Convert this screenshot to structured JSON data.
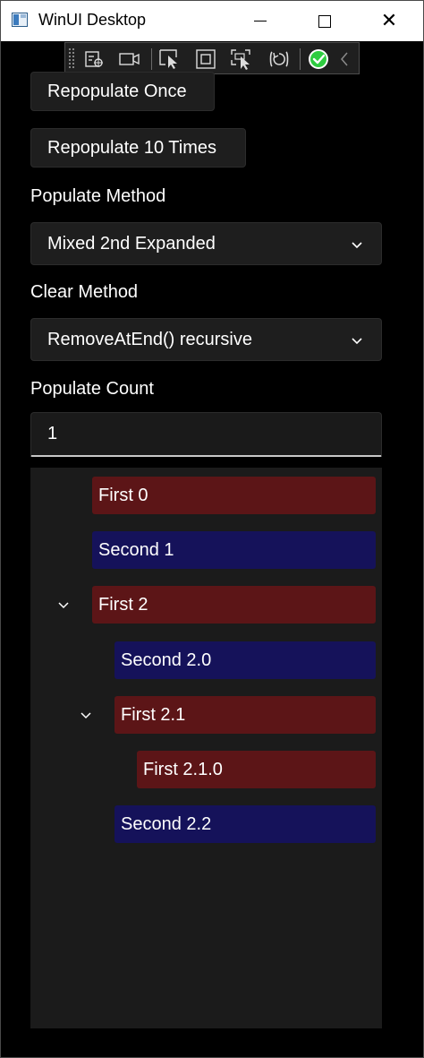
{
  "window": {
    "title": "WinUI Desktop"
  },
  "titlebar_buttons": {
    "minimize_icon": "minimize-icon",
    "maximize_icon": "maximize-icon",
    "close_icon": "close-icon",
    "close_glyph": "✕"
  },
  "devtools": {
    "icons": [
      "live-visual-tree-icon",
      "record-icon",
      "select-element-icon",
      "display-layout-adorners-icon",
      "track-focus-icon",
      "hot-reload-icon",
      "binding-check-icon",
      "collapse-toolbar-icon"
    ],
    "status_color": "#2ecc40"
  },
  "buttons": {
    "repopulate_once": "Repopulate Once",
    "repopulate_10": "Repopulate 10 Times"
  },
  "populate_method": {
    "label": "Populate Method",
    "selected": "Mixed 2nd Expanded"
  },
  "clear_method": {
    "label": "Clear Method",
    "selected": "RemoveAtEnd() recursive"
  },
  "populate_count": {
    "label": "Populate Count",
    "value": "1"
  },
  "tree": {
    "colors": {
      "first": "#5c1517",
      "second": "#15125a"
    },
    "items": [
      {
        "text": "First 0",
        "kind": "first",
        "level": 0,
        "expanded": false,
        "has_children": false
      },
      {
        "text": "Second 1",
        "kind": "second",
        "level": 0,
        "expanded": false,
        "has_children": false
      },
      {
        "text": "First 2",
        "kind": "first",
        "level": 0,
        "expanded": true,
        "has_children": true
      },
      {
        "text": "Second 2.0",
        "kind": "second",
        "level": 1,
        "expanded": false,
        "has_children": false
      },
      {
        "text": "First 2.1",
        "kind": "first",
        "level": 1,
        "expanded": true,
        "has_children": true
      },
      {
        "text": "First 2.1.0",
        "kind": "first",
        "level": 2,
        "expanded": false,
        "has_children": false
      },
      {
        "text": "Second 2.2",
        "kind": "second",
        "level": 1,
        "expanded": false,
        "has_children": false
      }
    ]
  }
}
